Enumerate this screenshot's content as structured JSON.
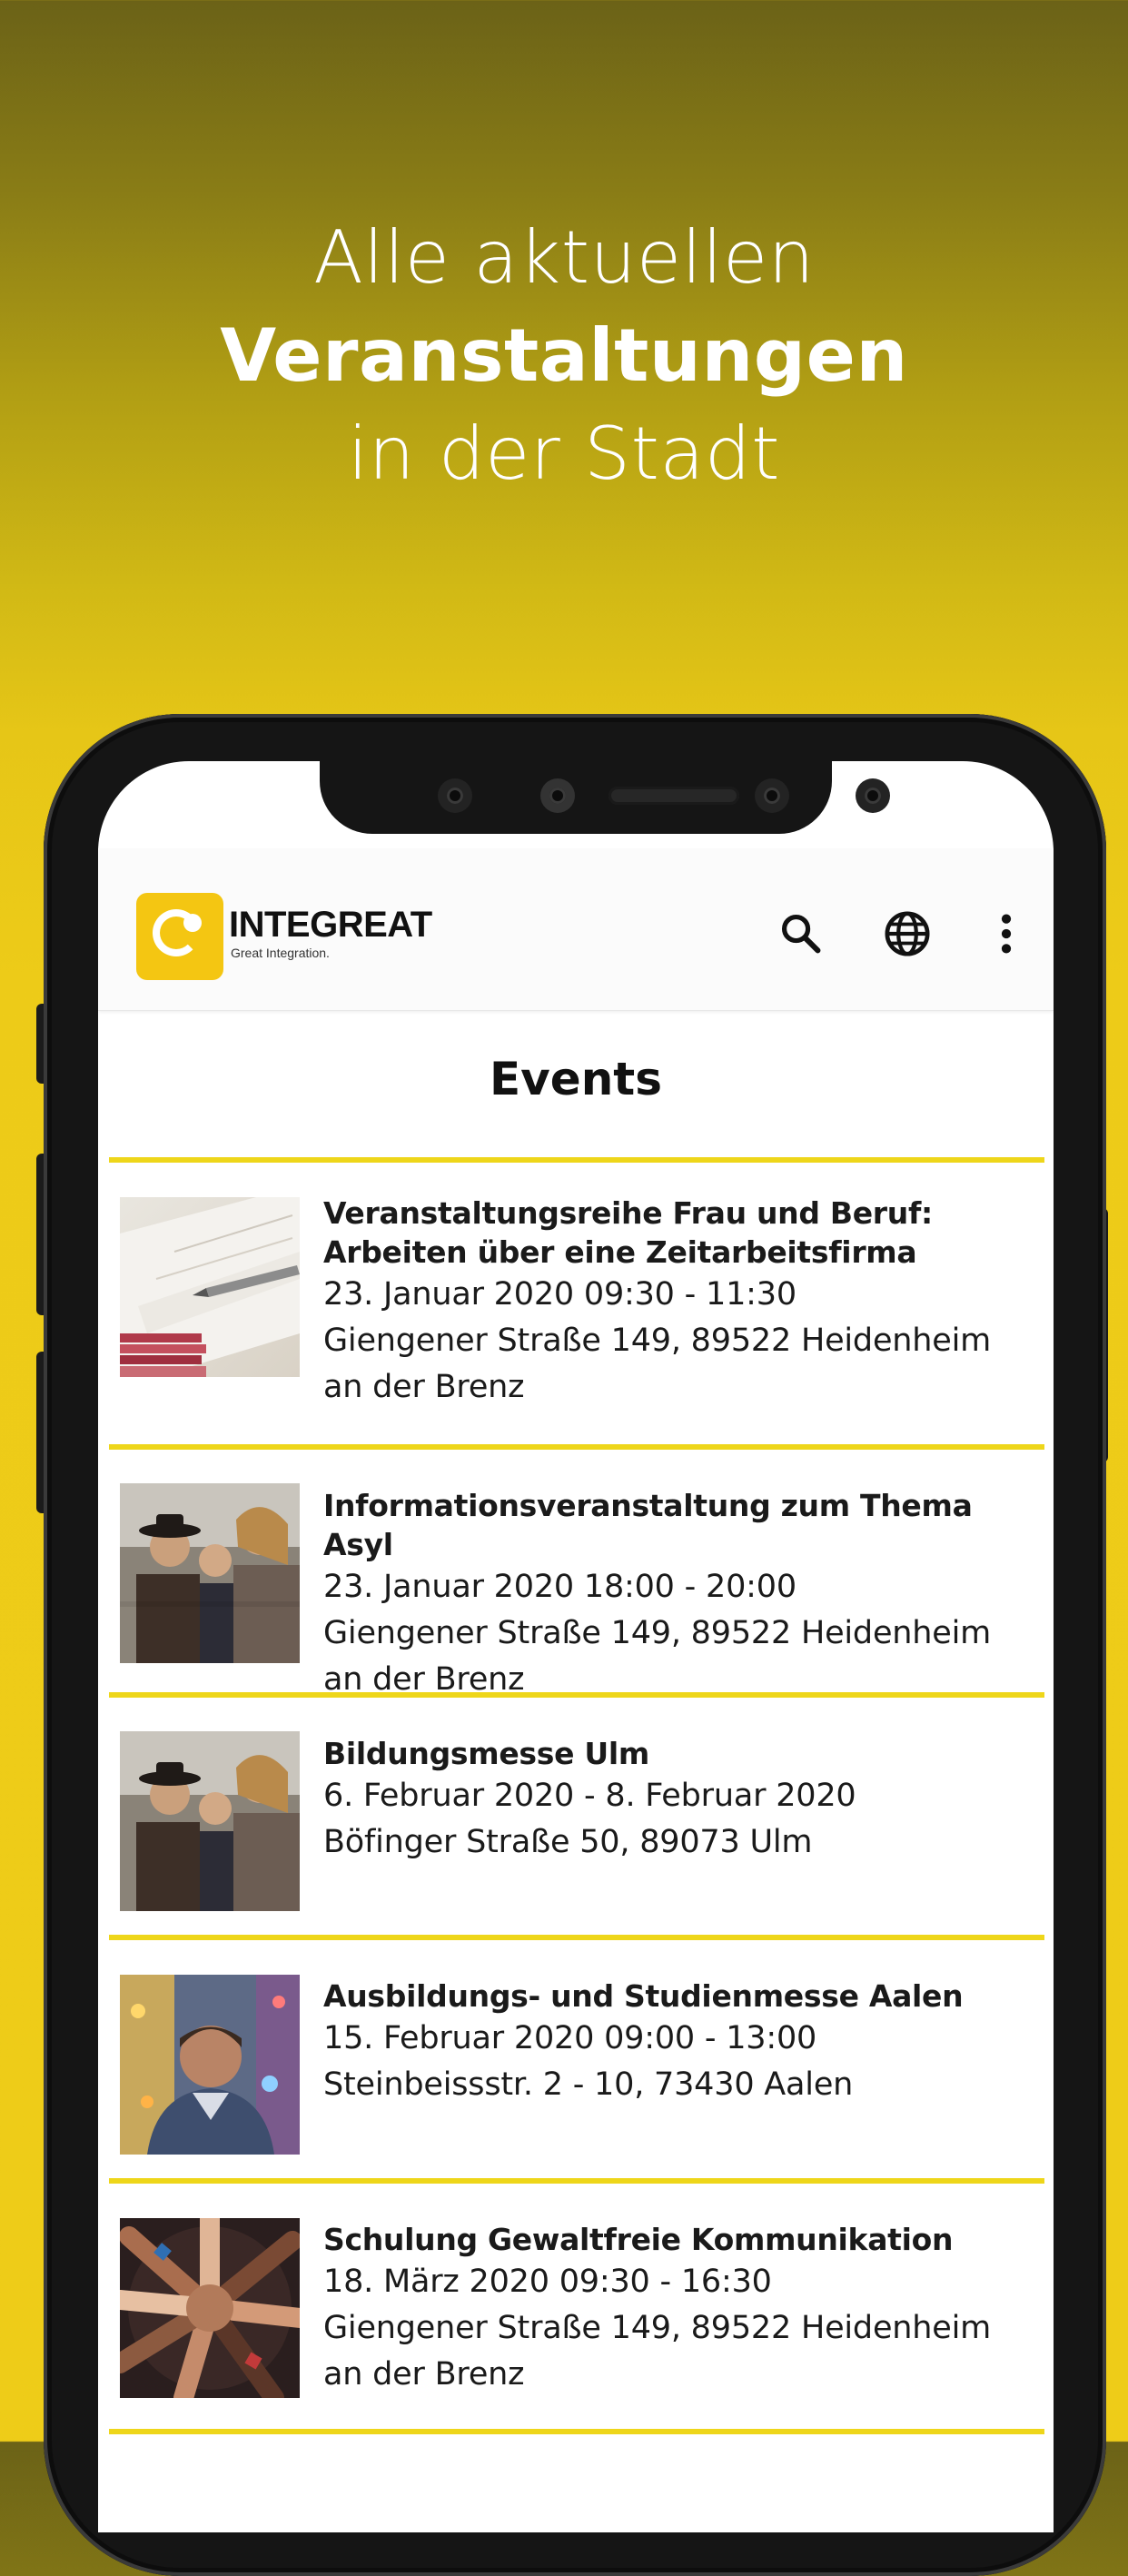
{
  "headline": {
    "line1": "Alle aktuellen",
    "line2": "Veranstaltungen",
    "line3": "in der Stadt"
  },
  "app": {
    "logo_text": "INTEGREAT",
    "logo_tagline": "Great Integration.",
    "icons": [
      "search-icon",
      "globe-icon",
      "more-vert-icon"
    ]
  },
  "page": {
    "title": "Events"
  },
  "events": [
    {
      "title_lines": [
        "Veranstaltungsreihe Frau und Beruf:",
        "Arbeiten über eine Zeitarbeitsfirma"
      ],
      "date": "23. Januar 2020 09:30 - 11:30",
      "address_lines": [
        "Giengener Straße 149, 89522 Heidenheim",
        "an der Brenz"
      ],
      "image": "book-and-pen-photo"
    },
    {
      "title_lines": [
        "Informationsveranstaltung zum Thema Asyl"
      ],
      "date": "23. Januar 2020 18:00 - 20:00",
      "address_lines": [
        "Giengener Straße 149, 89522 Heidenheim",
        "an der Brenz"
      ],
      "image": "group-of-people-photo"
    },
    {
      "title_lines": [
        "Bildungsmesse Ulm"
      ],
      "date": "6. Februar 2020 - 8. Februar 2020",
      "address_lines": [
        "Böfinger Straße 50, 89073 Ulm"
      ],
      "image": "group-of-people-photo"
    },
    {
      "title_lines": [
        "Ausbildungs- und Studienmesse Aalen"
      ],
      "date": "15. Februar 2020 09:00 - 13:00",
      "address_lines": [
        "Steinbeissstr. 2 - 10, 73430  Aalen"
      ],
      "image": "man-in-city-photo"
    },
    {
      "title_lines": [
        "Schulung Gewaltfreie Kommunikation"
      ],
      "date": "18. März 2020 09:30 - 16:30",
      "address_lines": [
        "Giengener Straße 149, 89522 Heidenheim",
        "an der Brenz"
      ],
      "image": "hands-together-photo"
    }
  ],
  "colors": {
    "accent": "#EED61A",
    "background_top": "#6B6217",
    "background_bottom": "#EECC18",
    "logo": "#F4C612"
  }
}
